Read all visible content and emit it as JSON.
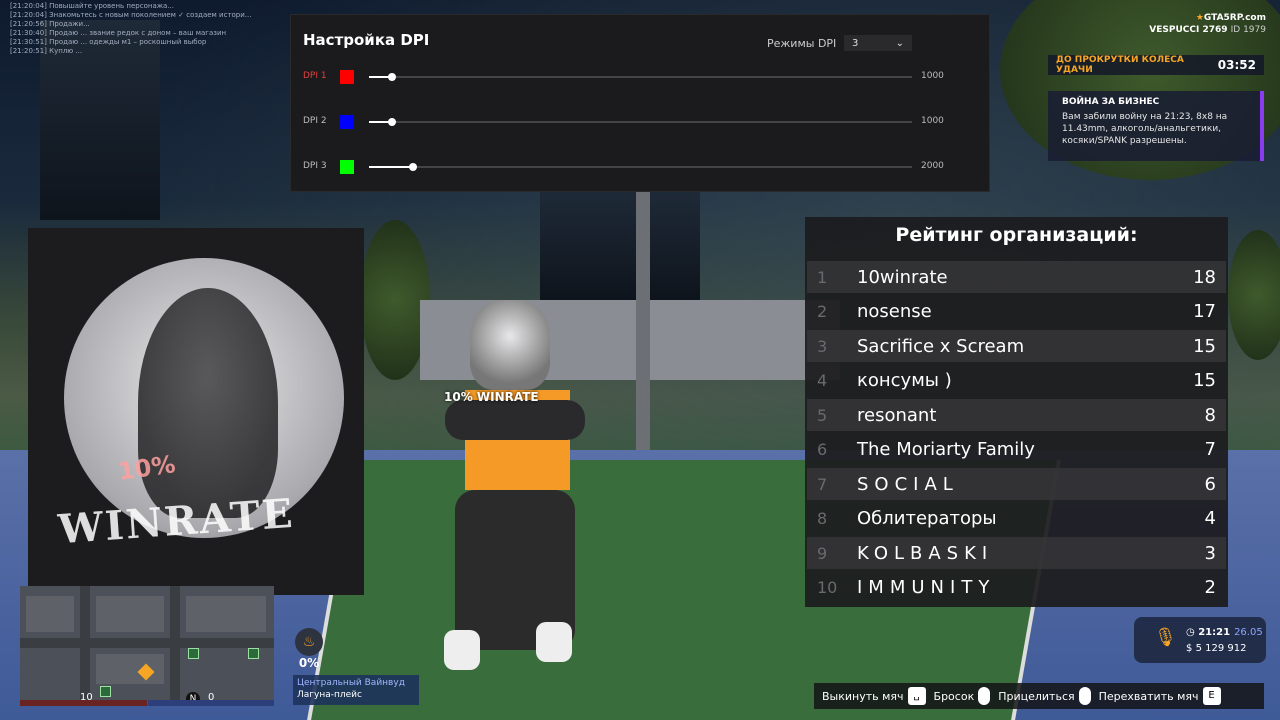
{
  "chat": [
    "[21:20:04] Повышайте уровень персонажа... ",
    "[21:20:04] Знакомьтесь с новым поколением ✓ создаем истори...",
    "[21:20:56] Продажи... ",
    "[21:30:40] Продаю ... звание редок с доном – ваш магазин",
    "[21:30:51] Продаю ... одежды м1 – роскошный выбор",
    "[21:20:51] Куплю ..."
  ],
  "logo": {
    "brand": "GTA5RP.com",
    "server": "VESPUCCI 2769",
    "id": "ID 1979"
  },
  "wheel": {
    "label": "ДО ПРОКРУТКИ КОЛЕСА УДАЧИ",
    "time": "03:52"
  },
  "war": {
    "title": "ВОЙНА ЗА БИЗНЕС",
    "body": "Вам забили войну на 21:23, 8x8 на 11.43mm, алкоголь/анальгетики, косяки/SPANK разрешены."
  },
  "dpi": {
    "title": "Настройка DPI",
    "mode_label": "Режимы DPI",
    "mode_value": "3",
    "rows": [
      {
        "label": "DPI 1",
        "color": "#ff0000",
        "value": "1000",
        "level": 0.04
      },
      {
        "label": "DPI 2",
        "color": "#0000ff",
        "value": "1000",
        "level": 0.04
      },
      {
        "label": "DPI 3",
        "color": "#00ff00",
        "value": "2000",
        "level": 0.08
      }
    ]
  },
  "poster": {
    "pct": "10%",
    "text": "WINRATE"
  },
  "player": {
    "tag": "10% WINRATE"
  },
  "rating": {
    "title": "Рейтинг организаций:",
    "rows": [
      {
        "n": "1",
        "name": "10winrate",
        "score": "18"
      },
      {
        "n": "2",
        "name": "nosense",
        "score": "17"
      },
      {
        "n": "3",
        "name": "Sacrifice x Scream",
        "score": "15"
      },
      {
        "n": "4",
        "name": "консумы )",
        "score": "15"
      },
      {
        "n": "5",
        "name": "resonant",
        "score": "8"
      },
      {
        "n": "6",
        "name": "The Moriarty Family",
        "score": "7"
      },
      {
        "n": "7",
        "name": "SOCIAL",
        "score": "6"
      },
      {
        "n": "8",
        "name": "Облитераторы",
        "score": "4"
      },
      {
        "n": "9",
        "name": "KOLBASKI",
        "score": "3"
      },
      {
        "n": "10",
        "name": "IMMUNITY",
        "score": "2"
      }
    ]
  },
  "minimap": {
    "left_value": "10",
    "right_value": "0",
    "north": "N"
  },
  "hunger": {
    "pct": "0%"
  },
  "location": {
    "zone": "Центральный Вайнвуд",
    "street": "Лагуна-плейс"
  },
  "clock": {
    "time": "21:21",
    "date": "26.05",
    "money": "5 129 912",
    "money_symbol": "$"
  },
  "hints": [
    {
      "label": "Выкинуть мяч",
      "key": "␣"
    },
    {
      "label": "Бросок",
      "key": ""
    },
    {
      "label": "Прицелиться",
      "key": ""
    },
    {
      "label": "Перехватить мяч",
      "key": "E"
    }
  ]
}
